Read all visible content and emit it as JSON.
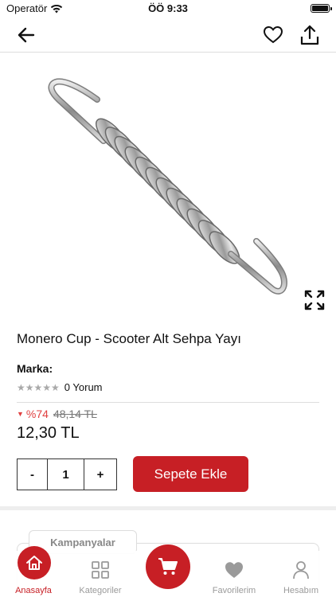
{
  "status_bar": {
    "carrier": "Operatör",
    "time": "ÖÖ 9:33"
  },
  "product": {
    "title": "Monero Cup - Scooter Alt Sehpa Yayı",
    "brand_label": "Marka:",
    "rating": {
      "stars": 0,
      "max_stars": 5,
      "reviews_label": "0 Yorum"
    },
    "discount": "%74",
    "old_price": "48,14 TL",
    "price": "12,30 TL",
    "quantity": "1"
  },
  "actions": {
    "minus": "-",
    "plus": "+",
    "add_to_cart": "Sepete Ekle"
  },
  "campaign": {
    "tab_label": "Kampanyalar"
  },
  "tab_bar": {
    "home": "Anasayfa",
    "categories": "Kategoriler",
    "favorites": "Favorilerim",
    "account": "Hesabım"
  },
  "colors": {
    "accent": "#c71f25",
    "discount": "#e04040",
    "inactive": "#9a9a9a"
  }
}
